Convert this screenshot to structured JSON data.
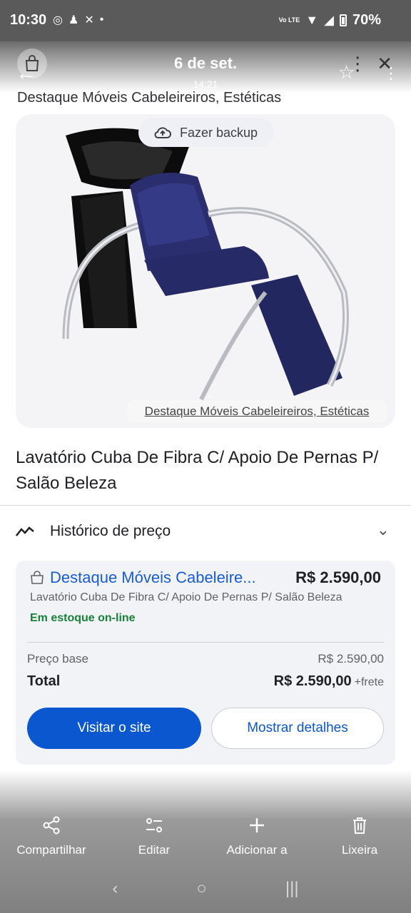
{
  "status_bar": {
    "time": "10:30",
    "network": "Vo LTE",
    "battery": "70%"
  },
  "viewer": {
    "date": "6 de set.",
    "time": "14:21"
  },
  "merchant_header": "Destaque Móveis Cabeleireiros, Estéticas",
  "backup_chip": {
    "label": "Fazer backup",
    "icon": "cloud-upload-icon"
  },
  "image_caption": "Destaque Móveis Cabeleireiros, Estéticas",
  "product_title": "Lavatório Cuba De Fibra C/ Apoio De Pernas P/ Salão Beleza",
  "price_history": {
    "label": "Histórico de preço"
  },
  "offer": {
    "store": "Destaque Móveis Cabeleire...",
    "price": "R$ 2.590,00",
    "description": "Lavatório Cuba De Fibra C/ Apoio De Pernas P/ Salão Beleza",
    "stock": "Em estoque on-line",
    "base_label": "Preço base",
    "base_value": "R$ 2.590,00",
    "total_label": "Total",
    "total_value": "R$ 2.590,00",
    "shipping": "+frete",
    "visit_button": "Visitar o site",
    "details_button": "Mostrar detalhes"
  },
  "actions": [
    {
      "label": "Compartilhar",
      "icon": "share-icon"
    },
    {
      "label": "Editar",
      "icon": "edit-sliders-icon"
    },
    {
      "label": "Adicionar a",
      "icon": "plus-icon"
    },
    {
      "label": "Lixeira",
      "icon": "trash-icon"
    }
  ],
  "colors": {
    "accent_blue": "#0b57d0",
    "link_blue": "#1a5bd6",
    "stock_green": "#188038"
  }
}
